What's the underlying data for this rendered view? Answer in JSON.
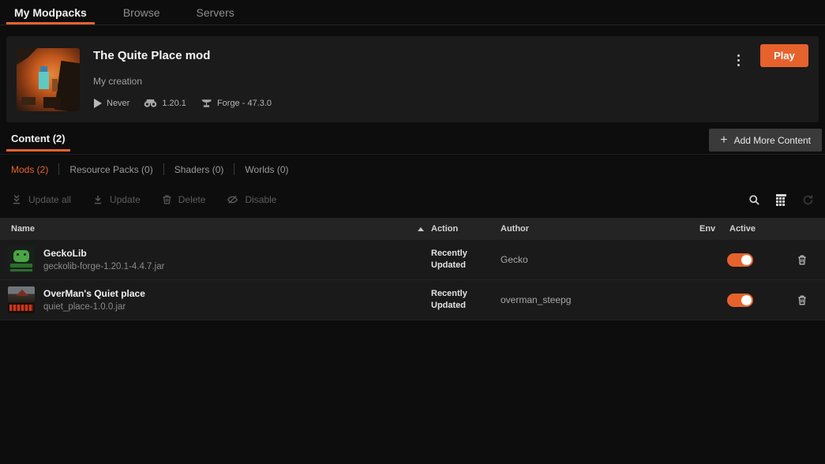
{
  "colors": {
    "accent": "#e6622d",
    "card_bg": "#1b1b1b",
    "table_header_bg": "#242424",
    "row_bg": "#1a1a1a"
  },
  "nav": {
    "tabs": [
      {
        "label": "My Modpacks",
        "active": true
      },
      {
        "label": "Browse",
        "active": false
      },
      {
        "label": "Servers",
        "active": false
      }
    ]
  },
  "modpack": {
    "title": "The Quite Place mod",
    "subtitle": "My creation",
    "last_played": "Never",
    "game_version": "1.20.1",
    "mod_loader": "Forge - 47.3.0",
    "play_label": "Play"
  },
  "content": {
    "tab_label": "Content (2)",
    "add_more_label": "Add More Content",
    "subtabs": [
      {
        "label": "Mods (2)",
        "active": true
      },
      {
        "label": "Resource Packs (0)",
        "active": false
      },
      {
        "label": "Shaders (0)",
        "active": false
      },
      {
        "label": "Worlds (0)",
        "active": false
      }
    ],
    "toolbar": {
      "update_all": "Update all",
      "update": "Update",
      "delete": "Delete",
      "disable": "Disable"
    }
  },
  "table": {
    "headers": {
      "name": "Name",
      "action": "Action",
      "author": "Author",
      "env": "Env",
      "active": "Active"
    },
    "rows": [
      {
        "name": "GeckoLib",
        "file": "geckolib-forge-1.20.1-4.4.7.jar",
        "action": "Recently Updated",
        "author": "Gecko",
        "active": true
      },
      {
        "name": "OverMan's Quiet place",
        "file": "quiet_place-1.0.0.jar",
        "action": "Recently Updated",
        "author": "overman_steepg",
        "active": true
      }
    ]
  }
}
